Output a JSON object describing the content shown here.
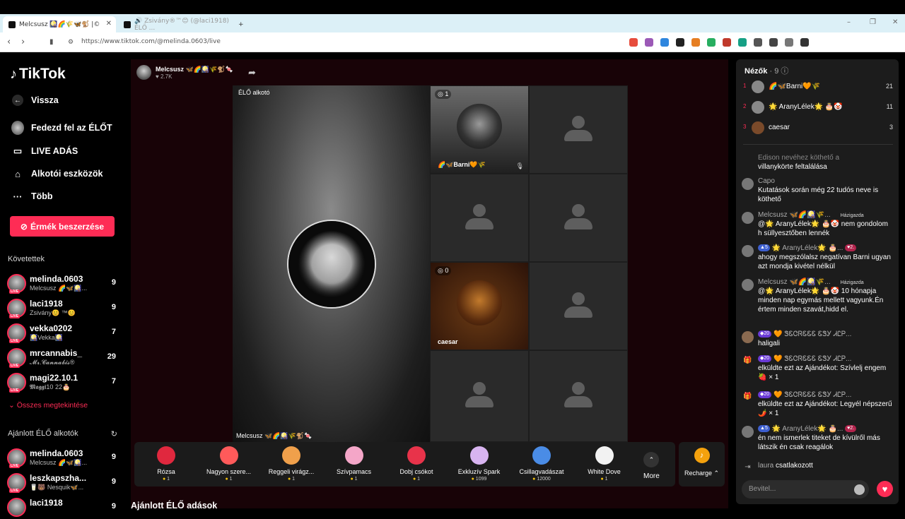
{
  "browser": {
    "tabs": [
      {
        "title": "Melcsusz 🎑🌈🌾🦋🐒 |©",
        "active": true
      },
      {
        "title": "🔊 Zsivány®™😊 (@laci1918) ÉLŐ ...",
        "active": false
      }
    ],
    "new_tab": "+",
    "url": "https://www.tiktok.com/@melinda.0603/live",
    "window_controls": [
      "–",
      "❐",
      "✕"
    ],
    "ext_colors": [
      "#e74c3c",
      "#9b59b6",
      "#2e86de",
      "#222",
      "#e67e22",
      "#27ae60",
      "#c0392b",
      "#16a085",
      "#555",
      "#444",
      "#777",
      "#333"
    ]
  },
  "sidebar": {
    "logo": "TikTok",
    "nav": [
      {
        "label": "Vissza",
        "icon": "back-arrow-icon"
      },
      {
        "label": "Fedezd fel az ÉLŐT",
        "icon": "explore-avatar-icon"
      },
      {
        "label": "LIVE ADÁS",
        "icon": "video-camera-icon"
      },
      {
        "label": "Alkotói eszközök",
        "icon": "creator-tools-icon"
      },
      {
        "label": "Több",
        "icon": "more-dots-icon"
      }
    ],
    "coin_button": "Érmék beszerzése",
    "following_title": "Követettek",
    "following": [
      {
        "name": "melinda.0603",
        "sub": "Melcsusz 🌈🦋🎑...",
        "count": "9"
      },
      {
        "name": "laci1918",
        "sub": "Zsivány😊 ™😊",
        "count": "9"
      },
      {
        "name": "vekka0202",
        "sub": "🎑Vekka🎑",
        "count": "7"
      },
      {
        "name": "mrcannabis_",
        "sub": "𝓜𝓻.𝓒𝓪𝓷𝓷𝓪𝓫𝓲𝓼®",
        "count": "29"
      },
      {
        "name": "magi22.10.1",
        "sub": "𝕸𝖆𝖌𝖌𝖎10 22🎂",
        "count": "7"
      }
    ],
    "see_all": "Összes megtekintése",
    "recommended_title": "Ajánlott ÉLŐ alkotók",
    "recommended": [
      {
        "name": "melinda.0603",
        "sub": "Melcsusz 🌈🦋🎑...",
        "count": "9"
      },
      {
        "name": "leszkapszha...",
        "sub": "🥛🐻 Nesquik🦋...",
        "count": "9"
      },
      {
        "name": "laci1918",
        "sub": "",
        "count": "9"
      }
    ],
    "live_tag": "LIVE"
  },
  "stream": {
    "host_name": "Melcsusz 🦋🌈🎑🌾🐒🍬",
    "host_likes": "♥ 2.7K",
    "main_label": "ÉLŐ alkotó",
    "main_bottom": "Melcsusz 🦋🌈🎑🌾🐒🍬",
    "guest1_count": "1",
    "guest1_name": "🌈🦋Barni🧡🌾",
    "guest2_count": "0",
    "guest2_name": "caesar",
    "recommend_title": "Ajánlott ÉLŐ adások"
  },
  "gifts": [
    {
      "name": "Rózsa",
      "price": "1",
      "color": "#e0283e"
    },
    {
      "name": "Nagyon szere...",
      "price": "1",
      "color": "#ff5a5a"
    },
    {
      "name": "Reggeli virágz...",
      "price": "1",
      "color": "#f0a04b"
    },
    {
      "name": "Szívpamacs",
      "price": "1",
      "color": "#f4a6c8"
    },
    {
      "name": "Dobj csókot",
      "price": "1",
      "color": "#e8334a"
    },
    {
      "name": "Exkluzív Spark",
      "price": "1099",
      "color": "#d8b4f0"
    },
    {
      "name": "Csillagvadászat",
      "price": "12000",
      "color": "#4a8ce6"
    },
    {
      "name": "White Dove",
      "price": "1",
      "color": "#f2f2f2"
    }
  ],
  "gift_more": "More",
  "recharge": "Recharge ⌃",
  "chat": {
    "viewers_title": "Nézők",
    "viewers_count": "· 9",
    "top_viewers": [
      {
        "rank": "1",
        "name": "🌈🦋Barni🧡🌾",
        "score": "21"
      },
      {
        "rank": "2",
        "name": "🌟 AranyLélek🌟 🎂🤡",
        "score": "11"
      },
      {
        "rank": "3",
        "name": "caesar",
        "score": "3"
      }
    ],
    "messages": [
      {
        "user": "Edison nevéhez köthető a",
        "text": "villanykörte feltalálása"
      },
      {
        "user": "Capo",
        "text": "Kutatások során még 22 tudós neve is köthető"
      },
      {
        "user": "Melcsusz 🦋🌈🎑🌾...",
        "tag": "Házigazda",
        "text": "@🌟 AranyLélek🌟 🎂🤡 nem gondolom h süllyesztőben lennék"
      },
      {
        "user": "🌟 AranyLélek🌟 🎂...",
        "badge": "5",
        "badge2": "2.",
        "text": "ahogy megszólalsz negatívan Barni ugyan azt mondja kivétel nélkül"
      },
      {
        "user": "Melcsusz 🦋🌈🎑🌾...",
        "tag": "Házigazda",
        "text": "@🌟 AranyLélek🌟 🎂🤡 10 hónapja minden nap egymás mellett vagyunk.Én értem minden szavát,hidd el."
      },
      {
        "user": "🧡 ᏕᏋᏣᏒᏋᏋᏋ ᏋᏕᎩ ᏗᏝᏢ...",
        "badge": "20",
        "text": "haligali"
      },
      {
        "user": "🧡 ᏕᏋᏣᏒᏋᏋᏋ ᏋᏕᎩ ᏗᏝᏢ...",
        "badge": "20",
        "text": "elküldte ezt az Ajándékot: Szívlelj engem 🍓 × 1"
      },
      {
        "user": "🧡 ᏕᏋᏣᏒᏋᏋᏋ ᏋᏕᎩ ᏗᏝᏢ...",
        "badge": "20",
        "text": "elküldte ezt az Ajándékot: Legyél népszerű 🌶️ × 1"
      },
      {
        "user": "🌟 AranyLélek🌟 🎂...",
        "badge": "5",
        "badge2": "2.",
        "text": "én nem ismerlek titeket de kívülről más látszik én csak reagálok"
      }
    ],
    "joined_user": "laura",
    "joined_text": "csatlakozott",
    "input_placeholder": "Bevitel..."
  }
}
